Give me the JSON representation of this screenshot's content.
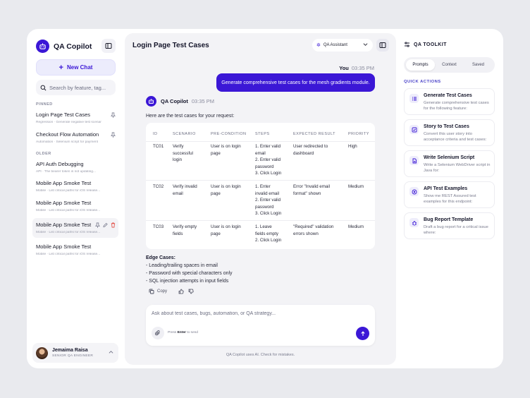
{
  "app": {
    "name": "QA Copilot",
    "brand_color": "#3b17d6"
  },
  "sidebar": {
    "new_chat_label": "New Chat",
    "search_placeholder": "Search by feature, tag...",
    "pinned_label": "PINNED",
    "older_label": "OLDER",
    "pinned": [
      {
        "title": "Login Page Test Cases",
        "subtitle": "Regression · Generate negative test scenar"
      },
      {
        "title": "Checkout Flow Automation",
        "subtitle": "Automation · Selenium script for payment"
      }
    ],
    "older": [
      {
        "title": "API Auth Debugging",
        "subtitle": "API · The bearer token is not updating..."
      },
      {
        "title": "Mobile App Smoke Test",
        "subtitle": "Mobile · List critical paths for iOS release..."
      },
      {
        "title": "Mobile App Smoke Test",
        "subtitle": "Mobile · List critical paths for iOS release..."
      },
      {
        "title": "Mobile App Smoke Test",
        "subtitle": "Mobile · List critical paths for iOS release..."
      },
      {
        "title": "Mobile App Smoke Test",
        "subtitle": "Mobile · List critical paths for iOS release..."
      }
    ],
    "user": {
      "name": "Jemaima Raisa",
      "role": "SENIOR QA ENGINEER"
    }
  },
  "main": {
    "title": "Login Page Test Cases",
    "assistant_select": "QA Assistant",
    "user_msg": {
      "author": "You",
      "time": "03:35 PM",
      "text": "Generate comprehensive test cases for the mesh gradients module."
    },
    "bot_msg": {
      "author": "QA Copilot",
      "time": "03:35 PM",
      "intro": "Here are the test cases for your request:",
      "table": {
        "headers": [
          "ID",
          "SCENARIO",
          "PRE-CONDITION",
          "STEPS",
          "EXPECTED RESULT",
          "PRIORITY"
        ],
        "rows": [
          {
            "id": "TC01",
            "scenario": [
              "Verify",
              "successful",
              "login"
            ],
            "pre": [
              "User is on login",
              "page"
            ],
            "steps": [
              "1. Enter valid",
              "email",
              "2. Enter valid",
              "password",
              "3. Click Login"
            ],
            "expected": [
              "User redirected to",
              "dashboard"
            ],
            "priority": "High"
          },
          {
            "id": "TC02",
            "scenario": [
              "Verify invalid",
              "email"
            ],
            "pre": [
              "User is on login",
              "page"
            ],
            "steps": [
              "1. Enter",
              "invalid email",
              "2. Enter valid",
              "password",
              "3. Click Login"
            ],
            "expected": [
              "Error \"Invalid email",
              "format\" shown"
            ],
            "priority": "Medium"
          },
          {
            "id": "TC03",
            "scenario": [
              "Verify empty",
              "fields"
            ],
            "pre": [
              "User is on login",
              "page"
            ],
            "steps": [
              "1. Leave",
              "fields empty",
              "2. Click Login"
            ],
            "expected": [
              "\"Required\" validation",
              "errors shown"
            ],
            "priority": "Medium"
          }
        ]
      },
      "edge_title": "Edge Cases:",
      "edge_cases": [
        "- Leading/trailing spaces in email",
        "- Password with special characters only",
        "- SQL injection attempts in input fields"
      ],
      "copy_label": "Copy"
    },
    "input_placeholder": "Ask about test cases, bugs, automation, or QA strategy...",
    "hint_pre": "Press",
    "hint_key": "Enter",
    "hint_post": "to send",
    "disclaimer": "QA Copilot uses AI. Check for mistakes."
  },
  "toolkit": {
    "title": "QA TOOLKIT",
    "tabs": [
      "Prompts",
      "Context",
      "Saved"
    ],
    "quick_actions_label": "QUICK ACTIONS",
    "actions": [
      {
        "title": "Generate Test Cases",
        "desc": [
          "Generate comprehensive test cases",
          "for the following feature:"
        ],
        "icon": "list-icon"
      },
      {
        "title": "Story to Test Cases",
        "desc": [
          "Convert this user story into",
          "acceptance criteria and test cases:"
        ],
        "icon": "checkbox-icon"
      },
      {
        "title": "Write Selenium Script",
        "desc": [
          "Write a Selenium WebDriver script in",
          "Java for:"
        ],
        "icon": "file-icon"
      },
      {
        "title": "API Test Examples",
        "desc": [
          "Show me REST Assured test",
          "examples for this endpoint:"
        ],
        "icon": "target-icon"
      },
      {
        "title": "Bug Report Template",
        "desc": [
          "Draft a bug report for a critical issue",
          "where:"
        ],
        "icon": "bug-icon"
      }
    ]
  }
}
